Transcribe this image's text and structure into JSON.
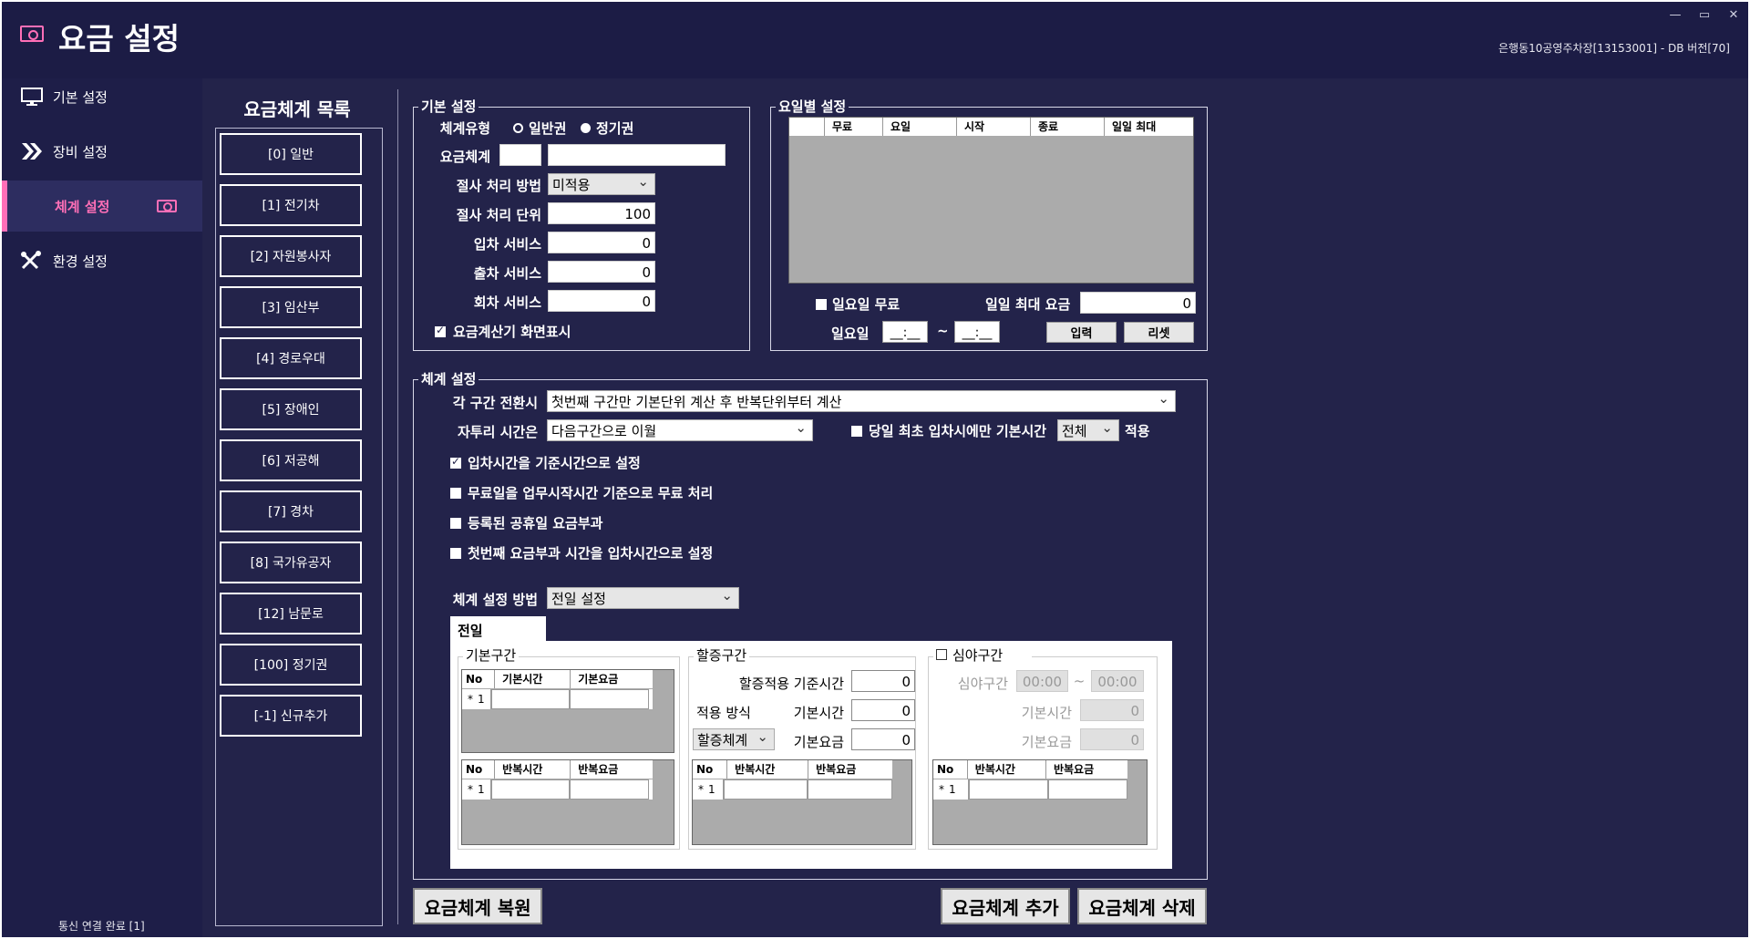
{
  "header": {
    "title": "요금 설정",
    "info": "은행동10공영주차장[13153001] - DB 버전[70]",
    "minimize": "—",
    "maximize": "▭",
    "close": "✕"
  },
  "sidebar": {
    "items": [
      {
        "label": "기본 설정",
        "icon": "monitor-icon"
      },
      {
        "label": "장비 설정",
        "icon": "chevrons-icon"
      },
      {
        "label": "체계 설정",
        "icon": "money-icon",
        "active": true
      },
      {
        "label": "환경 설정",
        "icon": "tools-icon"
      }
    ],
    "status": "통신 연결 완료 [1]",
    "accent_color": "#ff6fb7"
  },
  "fee_list": {
    "title": "요금체계 목록",
    "items": [
      "[0] 일반",
      "[1] 전기차",
      "[2] 자원봉사자",
      "[3] 임산부",
      "[4] 경로우대",
      "[5] 장애인",
      "[6] 저공해",
      "[7] 경차",
      "[8] 국가유공자",
      "[12] 남문로",
      "[100] 정기권",
      "[-1] 신규추가"
    ]
  },
  "basic": {
    "title": "기본 설정",
    "type_label": "체계유형",
    "type_general": "일반권",
    "type_season": "정기권",
    "fee_system_label": "요금체계",
    "fee_system_code": "",
    "fee_system_name": "",
    "rounding_method_label": "절사 처리 방법",
    "rounding_method_value": "미적용",
    "rounding_unit_label": "절사 처리 단위",
    "rounding_unit_value": "100",
    "entry_service_label": "입차 서비스",
    "entry_service_value": "0",
    "exit_service_label": "출차 서비스",
    "exit_service_value": "0",
    "return_service_label": "회차 서비스",
    "return_service_value": "0",
    "display_calc_label": "요금계산기 화면표시"
  },
  "daily": {
    "title": "요일별 설정",
    "columns": [
      "무료",
      "요일",
      "시작",
      "종료",
      "일일 최대"
    ],
    "sunday_free_label": "일요일 무료",
    "daily_max_label": "일일 최대 요금",
    "daily_max_value": "0",
    "sunday_label": "일요일",
    "time_from": "__:__",
    "time_sep": "~",
    "time_to": "__:__",
    "input_button": "입력",
    "reset_button": "리셋"
  },
  "system": {
    "title": "체계 설정",
    "transition_label": "각 구간 전환시",
    "transition_value": "첫번째 구간만 기본단위 계산 후 반복단위부터 계산",
    "remaining_label": "자투리 시간은",
    "remaining_value": "다음구간으로 이월",
    "first_entry_label": "당일 최초 입차시에만 기본시간",
    "first_entry_value": "전체",
    "apply_label": "적용",
    "opt1": "입차시간을 기준시간으로 설정",
    "opt2": "무료일을 업무시작시간 기준으로 무료 처리",
    "opt3": "등록된 공휴일 요금부과",
    "opt4": "첫번째 요금부과 시간을 입차시간으로 설정",
    "method_label": "체계 설정 방법",
    "method_value": "전일 설정",
    "tab_label": "전일",
    "base_section": {
      "title": "기본구간",
      "grid1_cols": [
        "No",
        "기본시간",
        "기본요금"
      ],
      "grid2_cols": [
        "No",
        "반복시간",
        "반복요금"
      ],
      "row_marker": "*",
      "row_no": "1"
    },
    "surcharge_section": {
      "title": "할증구간",
      "apply_time_label": "할증적용 기준시간",
      "apply_time_value": "0",
      "method_label": "적용 방식",
      "method_value": "할증체계",
      "base_time_label": "기본시간",
      "base_time_value": "0",
      "base_fee_label": "기본요금",
      "base_fee_value": "0",
      "grid_cols": [
        "No",
        "반복시간",
        "반복요금"
      ],
      "row_marker": "*",
      "row_no": "1"
    },
    "night_section": {
      "title": "심야구간",
      "range_label": "심야구간",
      "range_from": "00:00",
      "range_sep": "~",
      "range_to": "00:00",
      "base_time_label": "기본시간",
      "base_time_value": "0",
      "base_fee_label": "기본요금",
      "base_fee_value": "0",
      "grid_cols": [
        "No",
        "반복시간",
        "반복요금"
      ],
      "row_marker": "*",
      "row_no": "1"
    }
  },
  "actions": {
    "restore": "요금체계 복원",
    "add": "요금체계 추가",
    "delete": "요금체계 삭제"
  }
}
